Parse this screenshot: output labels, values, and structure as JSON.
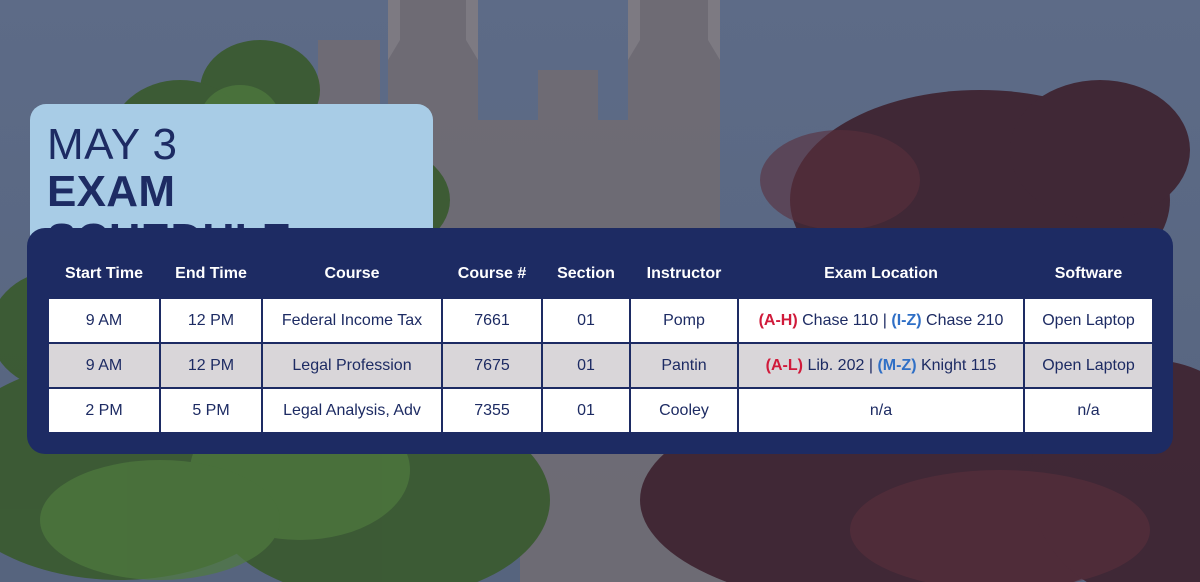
{
  "title": {
    "line1": "MAY 3",
    "line2": "EXAM SCHEDULE"
  },
  "colors": {
    "navy": "#1d2b63",
    "light_blue": "#a8cce6",
    "group_red": "#d01a3a",
    "group_blue": "#2f6fc6",
    "row_gray": "#d9d6d9"
  },
  "table": {
    "headers": [
      "Start Time",
      "End Time",
      "Course",
      "Course #",
      "Section",
      "Instructor",
      "Exam Location",
      "Software"
    ],
    "rows": [
      {
        "start": "9 AM",
        "end": "12 PM",
        "course": "Federal Income Tax",
        "course_num": "7661",
        "section": "01",
        "instructor": "Pomp",
        "location": {
          "group1": "(A-H)",
          "room1": "Chase 110",
          "separator": "|",
          "group2": "(I-Z)",
          "room2": "Chase 210"
        },
        "software": "Open Laptop"
      },
      {
        "start": "9 AM",
        "end": "12 PM",
        "course": "Legal Profession",
        "course_num": "7675",
        "section": "01",
        "instructor": "Pantin",
        "location": {
          "group1": "(A-L)",
          "room1": "Lib. 202",
          "separator": "|",
          "group2": "(M-Z)",
          "room2": "Knight 115"
        },
        "software": "Open Laptop"
      },
      {
        "start": "2 PM",
        "end": "5 PM",
        "course": "Legal Analysis, Adv",
        "course_num": "7355",
        "section": "01",
        "instructor": "Cooley",
        "location": {
          "text": "n/a"
        },
        "software": "n/a"
      }
    ]
  }
}
